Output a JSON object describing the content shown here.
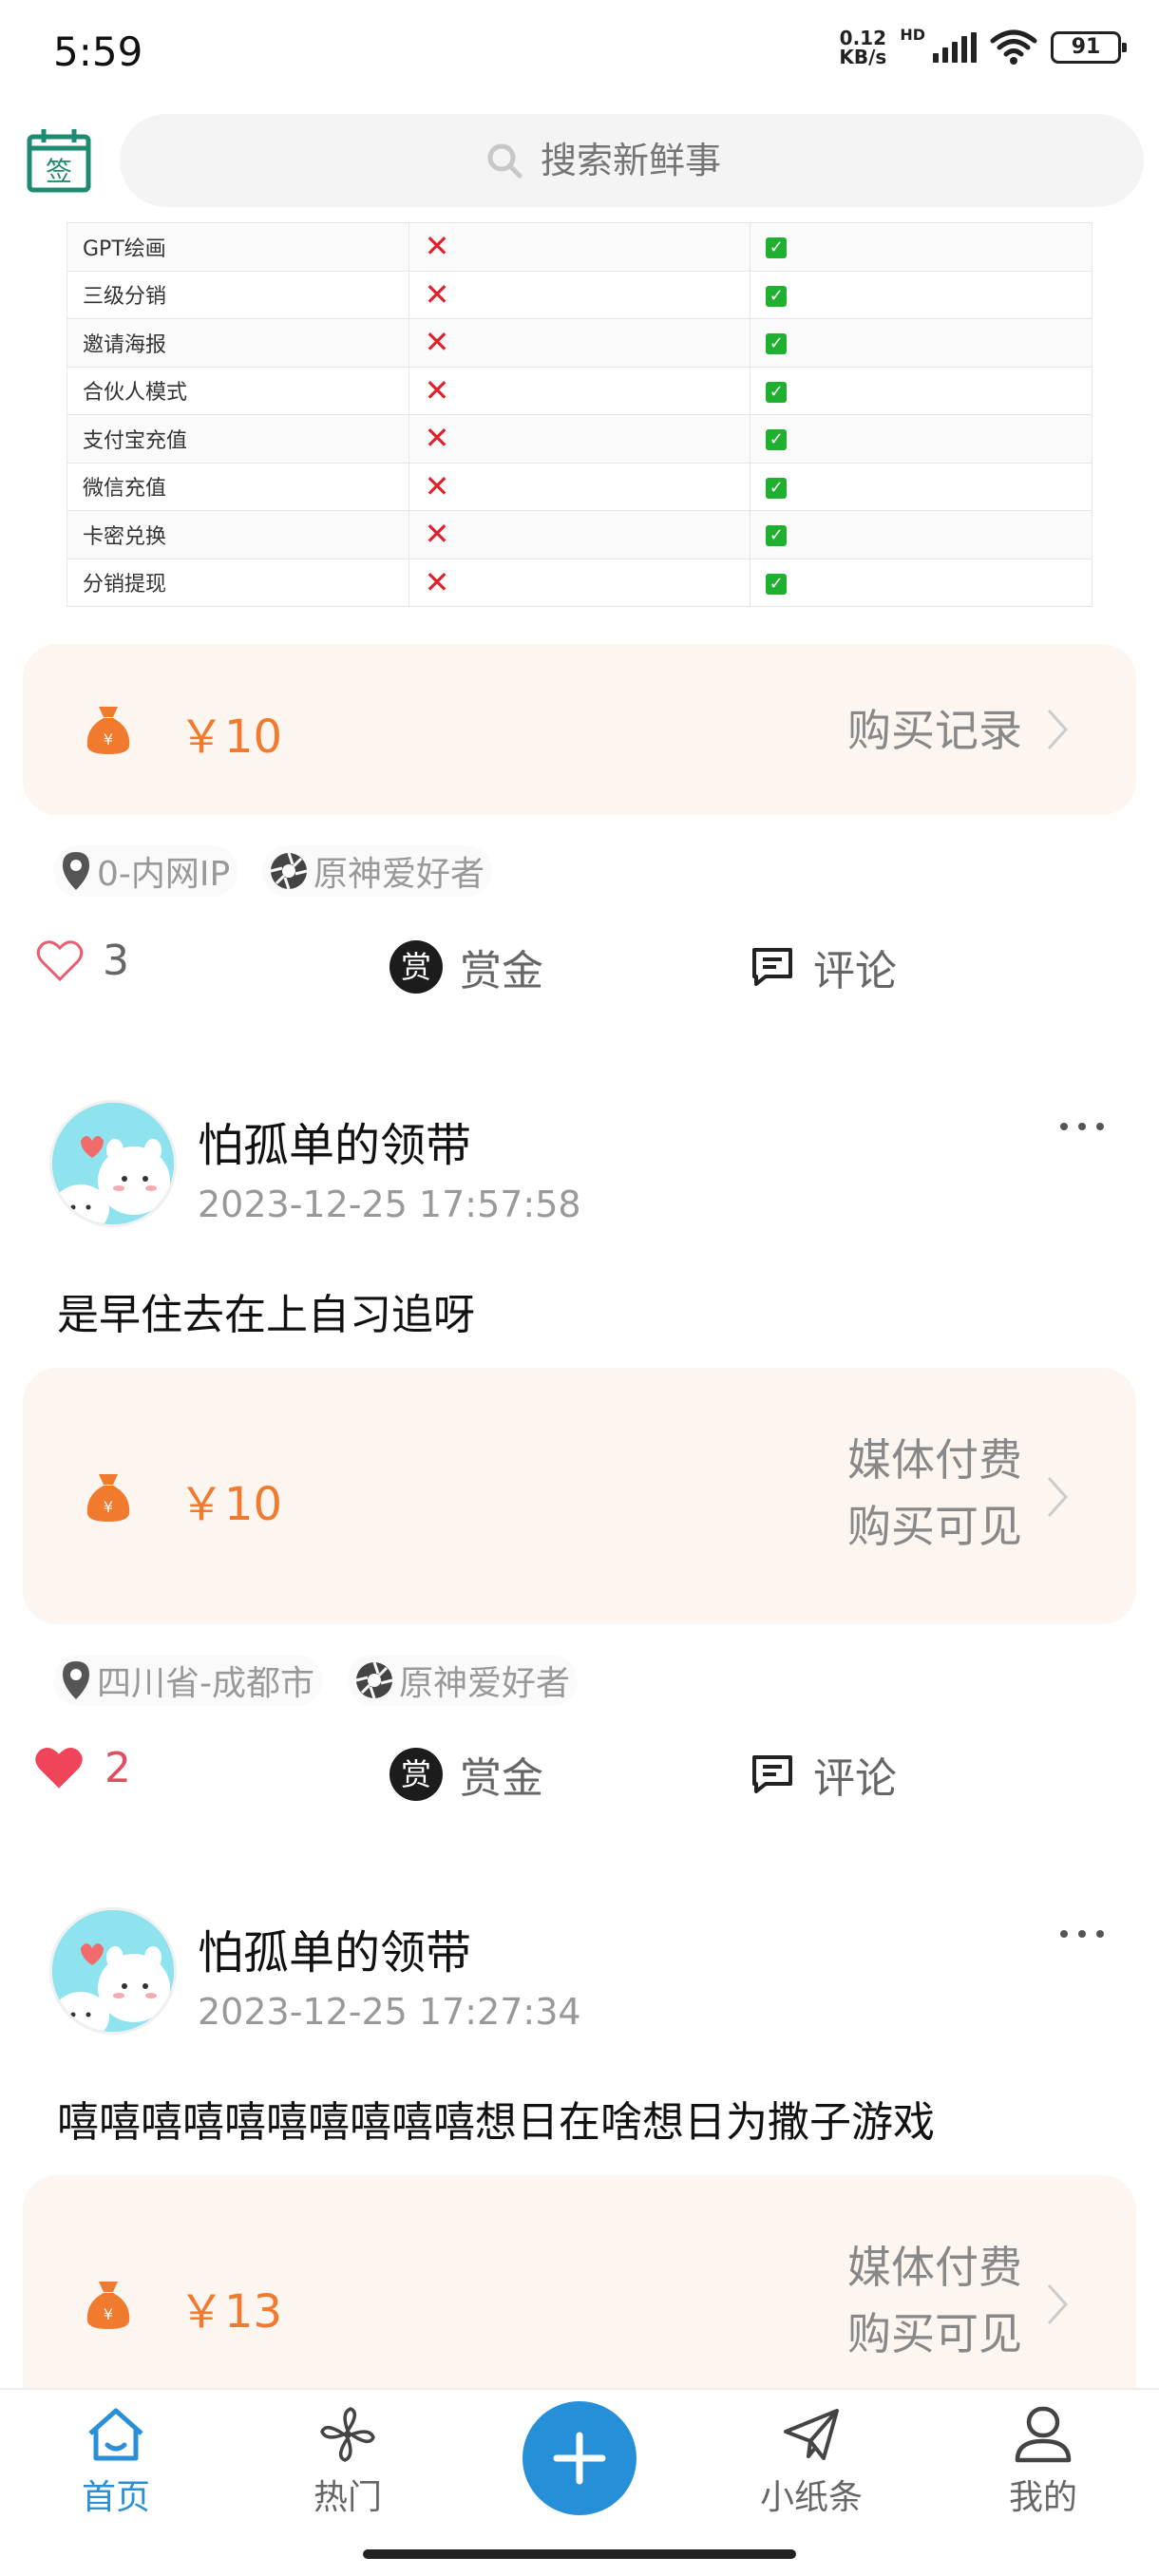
{
  "status_bar": {
    "time": "5:59",
    "net_speed_value": "0.12",
    "net_speed_unit": "KB/s",
    "hd_label": "HD",
    "battery": "91"
  },
  "search": {
    "placeholder": "搜索新鲜事",
    "sign_label": "签"
  },
  "feature_table": {
    "rows": [
      {
        "name": "GPT绘画"
      },
      {
        "name": "三级分销"
      },
      {
        "name": "邀请海报"
      },
      {
        "name": "合伙人模式"
      },
      {
        "name": "支付宝充值"
      },
      {
        "name": "微信充值"
      },
      {
        "name": "卡密兑换"
      },
      {
        "name": "分销提现"
      }
    ],
    "col_basic": "✕",
    "col_premium": "✓"
  },
  "post_0": {
    "price": "￥10",
    "purchase_link": "购买记录",
    "location": "0-内网IP",
    "circle": "原神爱好者",
    "likes": "3",
    "reward_label": "赏金",
    "reward_icon_char": "赏",
    "comment_label": "评论"
  },
  "post_1": {
    "username": "怕孤单的领带",
    "time": "2023-12-25 17:57:58",
    "text": "是早住去在上自习追呀",
    "price": "￥10",
    "pay_line1": "媒体付费",
    "pay_line2": "购买可见",
    "location": "四川省-成都市",
    "circle": "原神爱好者",
    "likes": "2",
    "reward_label": "赏金",
    "reward_icon_char": "赏",
    "comment_label": "评论"
  },
  "post_2": {
    "username": "怕孤单的领带",
    "time": "2023-12-25 17:27:34",
    "text": "嘻嘻嘻嘻嘻嘻嘻嘻嘻嘻想日在啥想日为撒子游戏",
    "price": "￥13",
    "pay_line1": "媒体付费",
    "pay_line2": "购买可见"
  },
  "bottom_nav": {
    "home": "首页",
    "hot": "热门",
    "notes": "小纸条",
    "mine": "我的"
  },
  "colors": {
    "accent": "#2590d8",
    "price": "#f07a2e",
    "like_active": "#f0445a"
  }
}
